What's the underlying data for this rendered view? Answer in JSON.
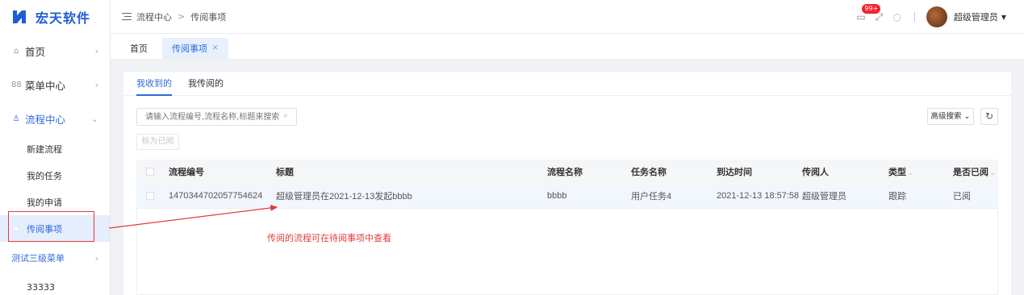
{
  "brand": {
    "name": "宏天软件"
  },
  "sidebar": {
    "items": [
      {
        "label": "首页",
        "icon": "home-icon"
      },
      {
        "label": "菜单中心",
        "icon": "grid-icon"
      },
      {
        "label": "流程中心",
        "icon": "flow-icon"
      }
    ],
    "subitems": [
      "新建流程",
      "我的任务",
      "我的申请",
      "传阅事项"
    ],
    "extra_menu": "测试三级菜单",
    "extra_sub": "33333"
  },
  "header": {
    "breadcrumb": [
      "流程中心",
      "传阅事项"
    ],
    "notify_badge": "99+",
    "username": "超级管理员"
  },
  "page_tabs": [
    {
      "label": "首页"
    },
    {
      "label": "传阅事项"
    }
  ],
  "sub_tabs": [
    "我收到的",
    "我传阅的"
  ],
  "search": {
    "placeholder": "请输入流程编号,流程名称,标题来搜索"
  },
  "buttons": {
    "mark_read": "标为已阅",
    "advanced": "高级搜索"
  },
  "table": {
    "columns": [
      "流程编号",
      "标题",
      "流程名称",
      "任务名称",
      "到达时间",
      "传阅人",
      "类型",
      "是否已阅"
    ],
    "rows": [
      {
        "id": "1470344702057754624",
        "title": "超级管理员在2021-12-13发起bbbb",
        "flow_name": "bbbb",
        "task_name": "用户任务4",
        "arrived": "2021-12-13 18:57:58",
        "sender": "超级管理员",
        "type": "跟踪",
        "read": "已阅"
      }
    ]
  },
  "annotation": {
    "text": "传阅的流程可在待阅事项中查看",
    "color": "#e23b3b"
  },
  "colors": {
    "accent": "#2f6bde",
    "brand": "#1f5cd6"
  }
}
